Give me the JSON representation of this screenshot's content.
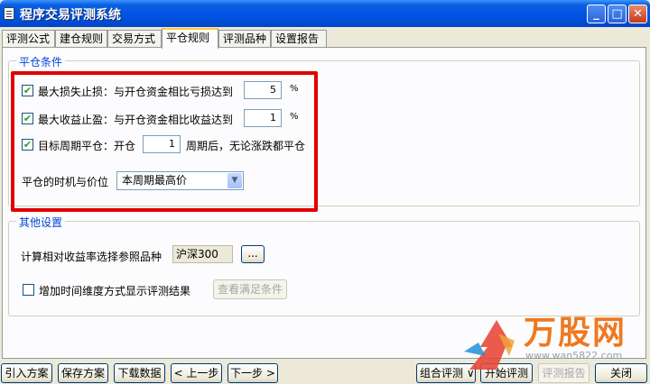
{
  "window": {
    "title": "程序交易评测系统",
    "controls": [
      "minimize",
      "maximize",
      "close"
    ]
  },
  "tabs": [
    "评测公式",
    "建仓规则",
    "交易方式",
    "平仓规则",
    "评测品种",
    "设置报告"
  ],
  "active_tab": "平仓规则",
  "close_conditions": {
    "group_title": "平仓条件",
    "stop_loss": {
      "checked": true,
      "label": "最大损失止损：与开仓资金相比亏损达到",
      "value": "5",
      "unit": "%"
    },
    "take_profit": {
      "checked": true,
      "label": "最大收益止盈：与开仓资金相比收益达到",
      "value": "1",
      "unit": "%"
    },
    "period": {
      "checked": true,
      "label": "目标周期平仓：开仓",
      "value": "1",
      "suffix": "周期后，无论涨跌都平仓"
    },
    "timing": {
      "label": "平仓的时机与价位",
      "selected": "本周期最高价"
    }
  },
  "other_settings": {
    "group_title": "其他设置",
    "reference_label": "计算相对收益率选择参照品种",
    "reference_value": "沪深300",
    "browse_label": "...",
    "time_dim": {
      "checked": false,
      "label": "增加时间维度方式显示评测结果"
    },
    "view_button": "查看满足条件"
  },
  "footer_left": [
    "引入方案",
    "保存方案",
    "下载数据",
    "< 上一步",
    "下一步 >"
  ],
  "footer_right": {
    "combo": "组合评测",
    "start": "开始评测",
    "report": "评测报告",
    "close": "关闭"
  },
  "watermark": {
    "text": "万股网",
    "url": "www.wan5822.com"
  },
  "colors": {
    "title_bar": "#0054e3",
    "highlight_box": "#e00000",
    "group_title": "#0046d5",
    "watermark": "#f07820"
  }
}
